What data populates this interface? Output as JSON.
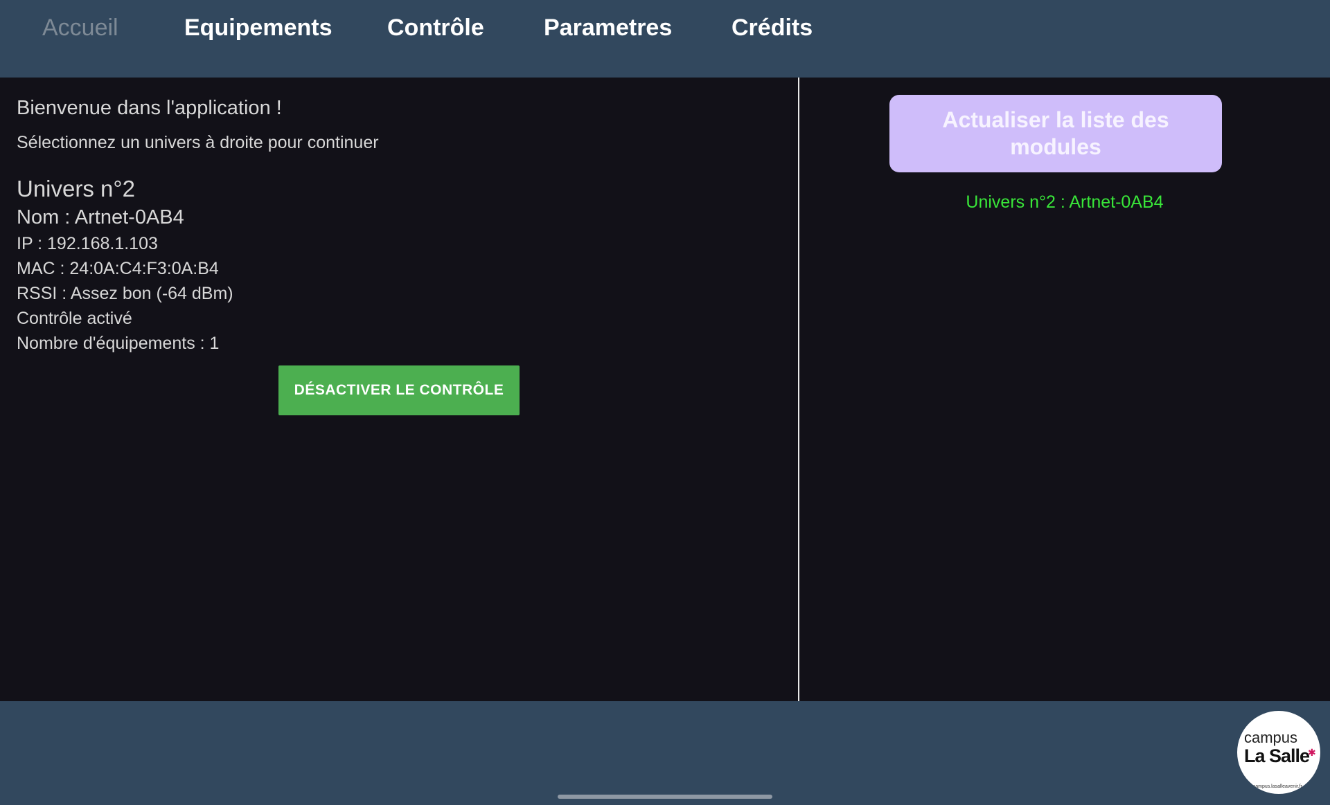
{
  "nav": {
    "tabs": [
      {
        "label": "Accueil",
        "active": true
      },
      {
        "label": "Equipements",
        "active": false
      },
      {
        "label": "Contrôle",
        "active": false
      },
      {
        "label": "Parametres",
        "active": false
      },
      {
        "label": "Crédits",
        "active": false
      }
    ]
  },
  "home": {
    "welcome_title": "Bienvenue dans l'application !",
    "welcome_subtitle": "Sélectionnez un univers à droite pour continuer",
    "universe": {
      "title": "Univers n°2",
      "name": "Nom : Artnet-0AB4",
      "ip": "IP : 192.168.1.103",
      "mac": "MAC : 24:0A:C4:F3:0A:B4",
      "rssi": "RSSI : Assez bon (-64 dBm)",
      "control_status": "Contrôle activé",
      "equipment_count": "Nombre d'équipements : 1"
    },
    "toggle_control_label": "DÉSACTIVER LE CONTRÔLE"
  },
  "modules": {
    "refresh_label": "Actualiser la liste des modules",
    "items": [
      {
        "label": "Univers n°2 : Artnet-0AB4"
      }
    ]
  },
  "logo": {
    "line1": "campus",
    "line2": "La Salle",
    "url": "www.campus.lasalleavenir.fr"
  },
  "colors": {
    "header_bg": "#32485e",
    "main_bg": "#121118",
    "toggle_button_bg": "#4caf50",
    "refresh_button_bg": "#cfbdfa",
    "module_text": "#39e639",
    "inactive_tab": "#7e8a96"
  }
}
